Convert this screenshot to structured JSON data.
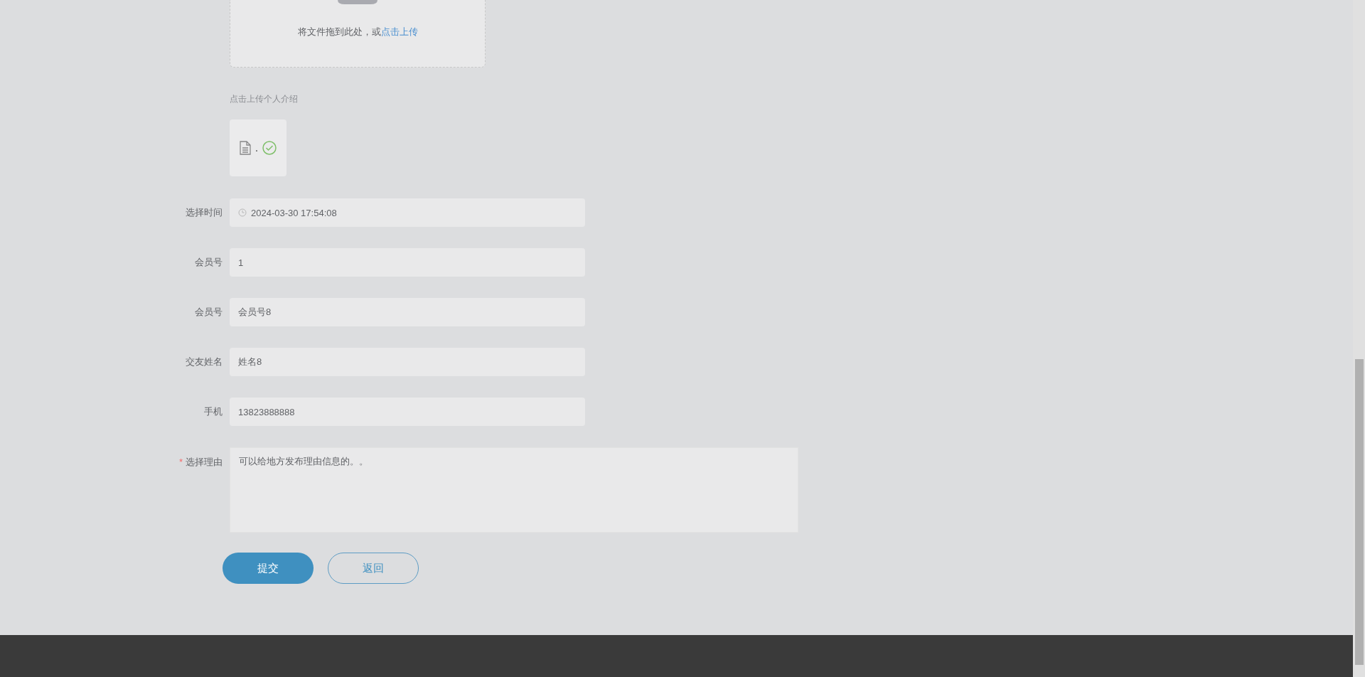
{
  "upload": {
    "hint": "将文件拖到此处，或",
    "link": "点击上传"
  },
  "attachment": {
    "tip": "点击上传个人介绍",
    "file_name": ".",
    "uploaded": true
  },
  "fields": [
    {
      "label": "选择时间",
      "value": "2024-03-30 17:54:08",
      "kind": "datetime"
    },
    {
      "label": "会员号",
      "value": "1",
      "kind": "text"
    },
    {
      "label": "会员号",
      "value": "会员号8",
      "kind": "text"
    },
    {
      "label": "交友姓名",
      "value": "姓名8",
      "kind": "text"
    },
    {
      "label": "手机",
      "value": "13823888888",
      "kind": "text"
    },
    {
      "label": "选择理由",
      "value": "可以给地方发布理由信息的。。",
      "kind": "textarea",
      "required_mark": "*"
    }
  ],
  "buttons": [
    {
      "label": "提交",
      "kind": "primary"
    },
    {
      "label": "返回",
      "kind": "outline"
    }
  ]
}
